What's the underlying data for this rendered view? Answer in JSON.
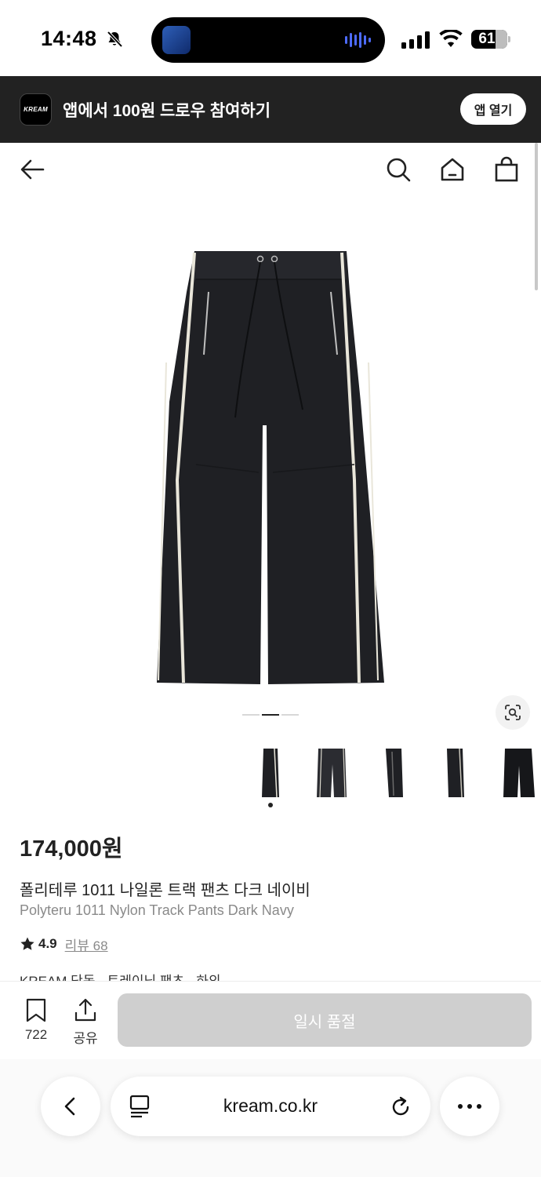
{
  "status_bar": {
    "time": "14:48",
    "battery": "61"
  },
  "app_banner": {
    "logo_text": "KREAM",
    "text": "앱에서 100원 드로우 참여하기",
    "open_button": "앱 열기"
  },
  "product": {
    "price": "174,000원",
    "name_ko": "폴리테루 1011 나일론 트랙 팬츠 다크 네이비",
    "name_en": "Polyteru 1011 Nylon Track Pants Dark Navy",
    "rating": "4.9",
    "review_label": "리뷰 68",
    "breadcrumb": "KREAM 단독 · 트레이닝 팬츠 · 하의",
    "image_count": 5,
    "selected_image": 1
  },
  "action_bar": {
    "bookmark_count": "722",
    "share_label": "공유",
    "soldout_label": "일시 품절"
  },
  "browser": {
    "url": "kream.co.kr"
  },
  "colors": {
    "banner_bg": "#222222",
    "pants": "#1f2024",
    "piping": "#e9e6da",
    "disabled_button": "#cfcfcf"
  }
}
